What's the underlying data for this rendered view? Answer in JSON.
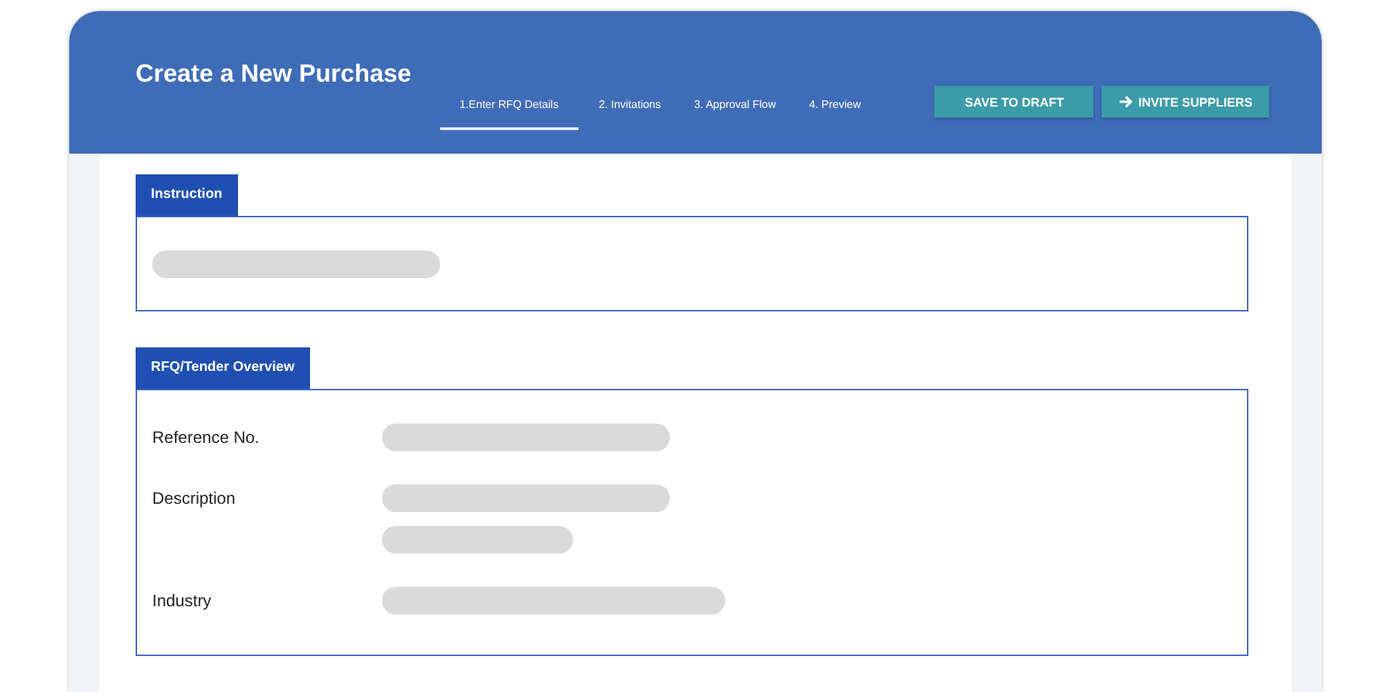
{
  "header": {
    "title": "Create a New Purchase",
    "buttons": [
      {
        "label": "SAVE TO DRAFT",
        "kind": "plain"
      },
      {
        "label": "INVITE SUPPLIERS",
        "kind": "arrow"
      }
    ],
    "steps": [
      {
        "label": "1.Enter RFQ Details",
        "selected": true
      },
      {
        "label": "2. Invitations",
        "selected": false
      },
      {
        "label": "3. Approval Flow",
        "selected": false
      },
      {
        "label": "4. Preview",
        "selected": false
      }
    ]
  },
  "sections": [
    {
      "title": "Instruction",
      "kind": "text"
    },
    {
      "title": "RFQ/Tender Overview",
      "kind": "form",
      "fields": [
        {
          "label": "Reference No.",
          "kind": "single"
        },
        {
          "label": "Description",
          "kind": "multiline"
        },
        {
          "label": "Industry",
          "kind": "wide"
        }
      ]
    }
  ]
}
